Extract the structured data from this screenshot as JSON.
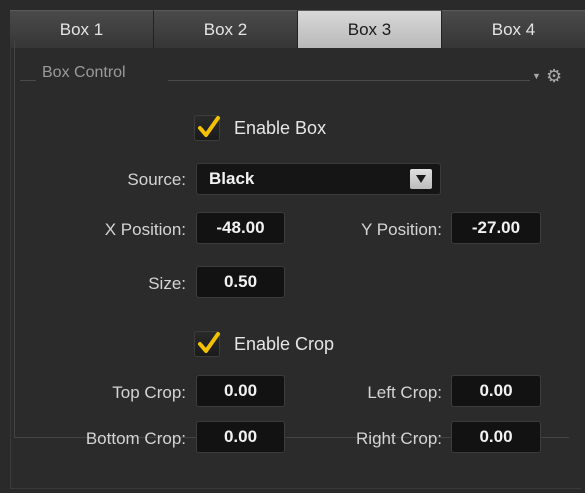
{
  "tabs": [
    "Box 1",
    "Box 2",
    "Box 3",
    "Box 4"
  ],
  "active_tab": "Box 3",
  "section": {
    "title": "Box Control"
  },
  "enable_box": {
    "label": "Enable Box",
    "checked": true
  },
  "source": {
    "label": "Source:",
    "value": "Black"
  },
  "x_position": {
    "label": "X Position:",
    "value": "-48.00"
  },
  "y_position": {
    "label": "Y Position:",
    "value": "-27.00"
  },
  "size": {
    "label": "Size:",
    "value": "0.50"
  },
  "enable_crop": {
    "label": "Enable Crop",
    "checked": true
  },
  "top_crop": {
    "label": "Top Crop:",
    "value": "0.00"
  },
  "left_crop": {
    "label": "Left Crop:",
    "value": "0.00"
  },
  "bottom_crop": {
    "label": "Bottom Crop:",
    "value": "0.00"
  },
  "right_crop": {
    "label": "Right Crop:",
    "value": "0.00"
  },
  "icons": [
    "gear-icon",
    "chevron-down-icon",
    "checkmark-icon",
    "dropdown-arrow-icon"
  ],
  "colors": {
    "check": "#f2c200",
    "active_tab": "#c9c9c9",
    "background": "#2b2b2b"
  }
}
